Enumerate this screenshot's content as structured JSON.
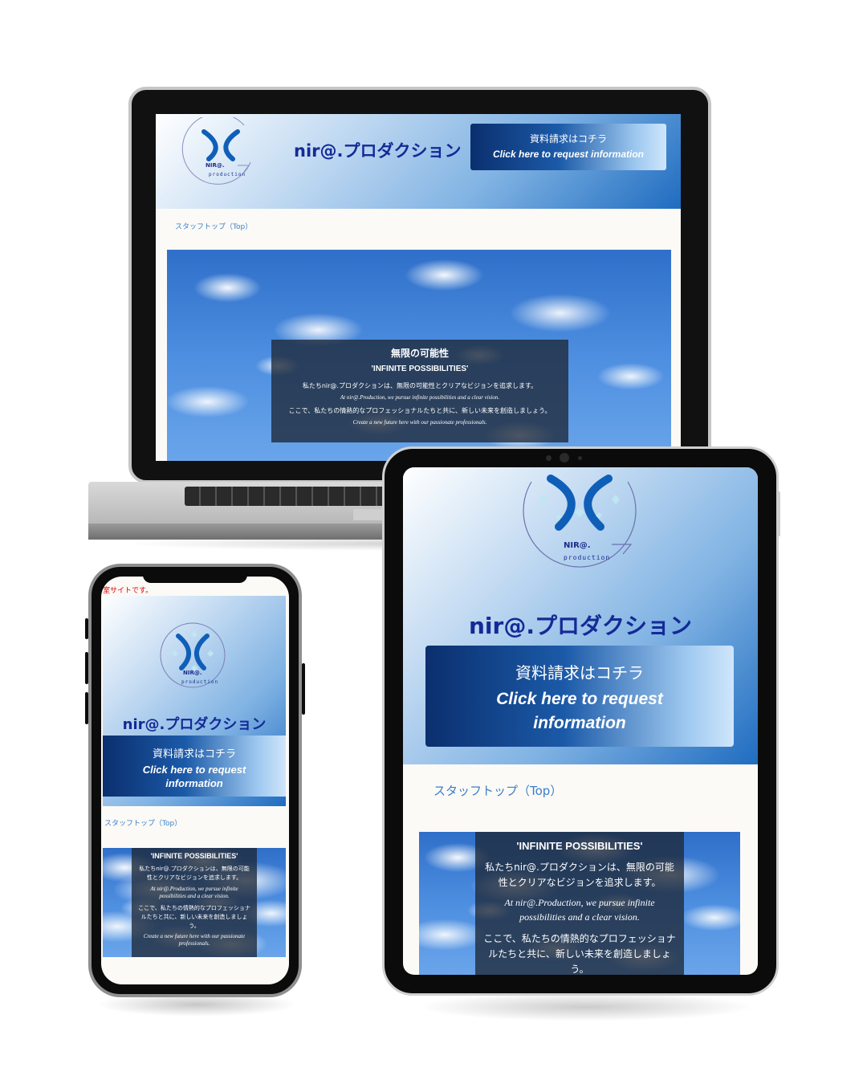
{
  "site": {
    "title": "nir@.プロダクション",
    "logo_text": "NIR@.",
    "logo_sub": "production",
    "cta_jp": "資料請求はコチラ",
    "cta_en": "Click here to request information",
    "breadcrumb": "スタッフトップ（Top）"
  },
  "hero": {
    "heading_jp": "無限の可能性",
    "heading_en": "'INFINITE POSSIBILITIES'",
    "line1_jp": "私たちnir@.プロダクションは、無限の可能性とクリアなビジョンを追求します。",
    "line1_en": "At nir@.Production, we pursue infinite possibilities and a clear vision.",
    "line2_jp": "ここで、私たちの情熱的なプロフェッショナルたちと共に、新しい未来を創造しましょう。",
    "line2_en": "Create a new future here with our passionate professionals."
  },
  "tablet": {
    "cta_en_line1": "Click here to request",
    "cta_en_line2": "information",
    "line1_en_a": "At nir@.Production, we pursue infinite",
    "line1_en_b": "possibilities and a clear vision.",
    "line2_jp_cut": "ここで、私たちの情熱的なプロフェッショナルたちと共に、新しい未来を創造しましょう。"
  },
  "phone": {
    "notice": "室サイトです。",
    "cta_en_line1": "Click here to request",
    "cta_en_line2": "information",
    "line1_en_a": "At nir@.Production, we pursue infinite",
    "line1_en_b": "possibilities and a clear vision.",
    "line2_en_a": "Create a new future here with our passionate",
    "line2_en_b": "professionals."
  },
  "colors": {
    "title": "#142a96",
    "breadcrumb": "#3a7fc9",
    "notice": "#e00000"
  }
}
